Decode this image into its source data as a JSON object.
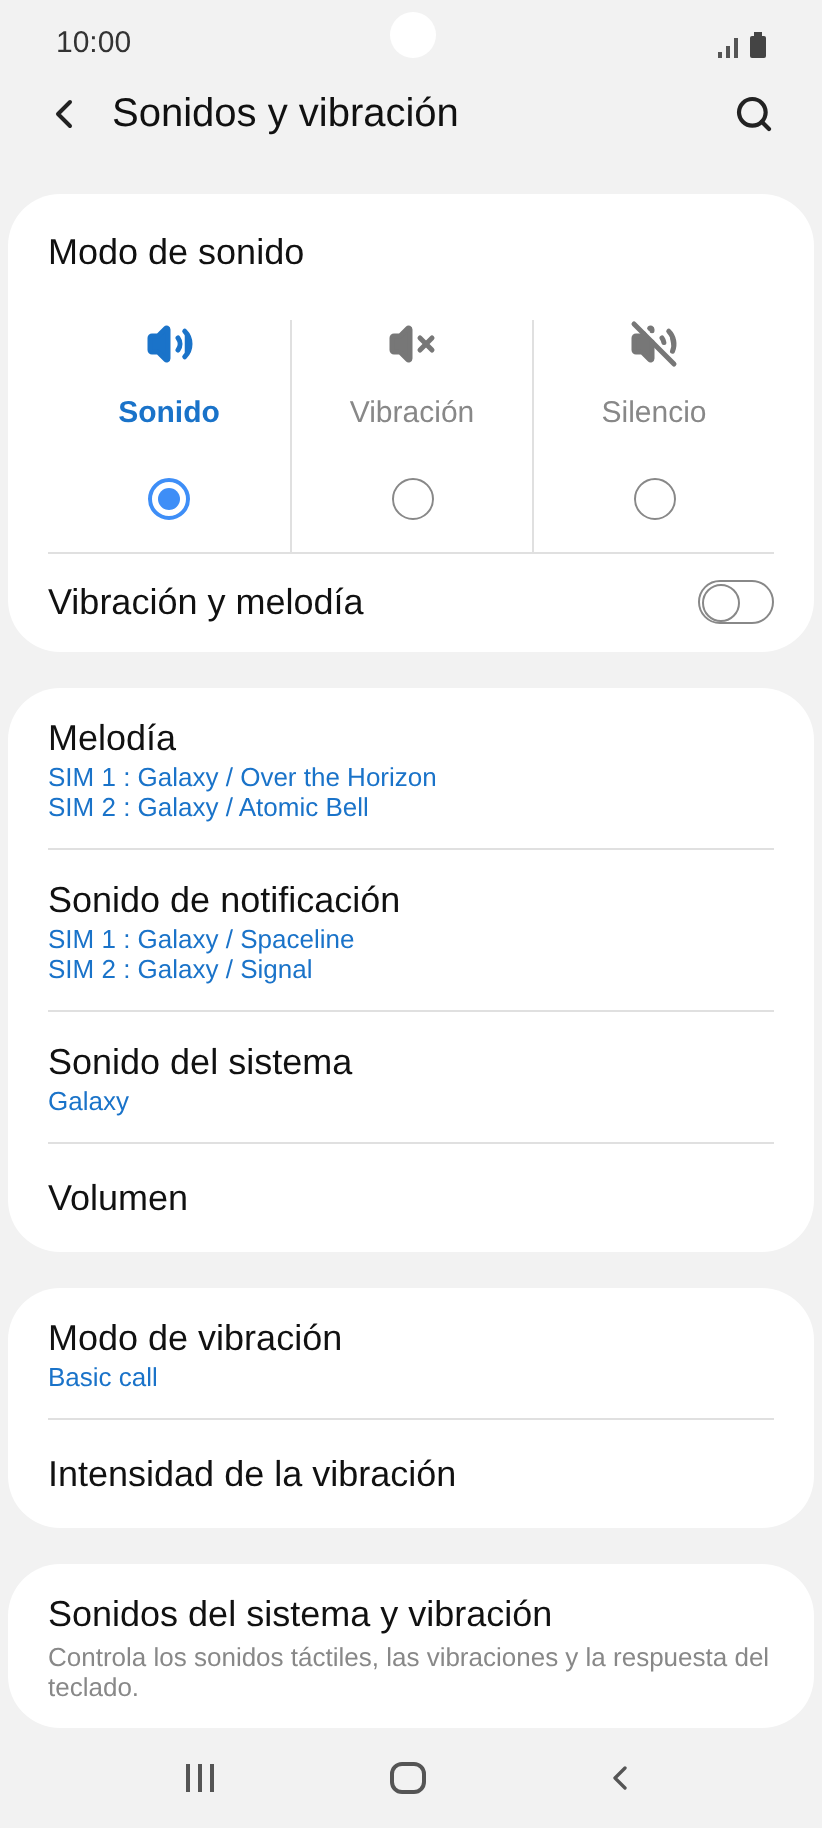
{
  "status_bar": {
    "time": "10:00"
  },
  "header": {
    "title": "Sonidos y vibración"
  },
  "sound_mode": {
    "title": "Modo de sonido",
    "options": [
      {
        "kind": "sound",
        "label": "Sonido",
        "selected": true
      },
      {
        "kind": "vibrate",
        "label": "Vibración",
        "selected": false
      },
      {
        "kind": "mute",
        "label": "Silencio",
        "selected": false
      }
    ],
    "toggle": {
      "label": "Vibración y melodía",
      "on": false
    }
  },
  "groups": [
    {
      "items": [
        {
          "title": "Melodía",
          "values": [
            "SIM 1 : Galaxy / Over the Horizon",
            "SIM 2 : Galaxy / Atomic Bell"
          ]
        },
        {
          "title": "Sonido de notificación",
          "values": [
            "SIM 1 : Galaxy / Spaceline",
            "SIM 2 : Galaxy / Signal"
          ]
        },
        {
          "title": "Sonido del sistema",
          "values": [
            "Galaxy"
          ]
        },
        {
          "title": "Volumen"
        }
      ]
    },
    {
      "items": [
        {
          "title": "Modo de vibración",
          "values": [
            "Basic call"
          ]
        },
        {
          "title": "Intensidad de la vibración"
        }
      ]
    },
    {
      "items": [
        {
          "title": "Sonidos del sistema y vibración",
          "description": "Controla los sonidos táctiles, las vibraciones y la respuesta del teclado."
        }
      ]
    }
  ]
}
